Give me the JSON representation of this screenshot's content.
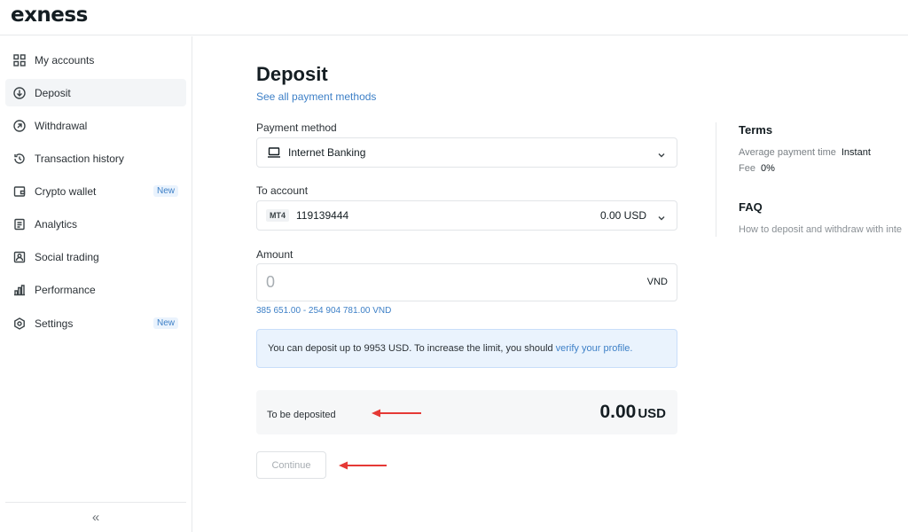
{
  "brand": {
    "logo_text": "exness"
  },
  "sidebar": {
    "items": [
      {
        "label": "My accounts",
        "icon": "grid-icon"
      },
      {
        "label": "Deposit",
        "icon": "arrow-down-circle-icon",
        "active": true
      },
      {
        "label": "Withdrawal",
        "icon": "arrow-up-right-circle-icon"
      },
      {
        "label": "Transaction history",
        "icon": "history-icon"
      },
      {
        "label": "Crypto wallet",
        "icon": "wallet-icon",
        "badge": "New"
      },
      {
        "label": "Analytics",
        "icon": "document-icon"
      },
      {
        "label": "Social trading",
        "icon": "social-trading-icon"
      },
      {
        "label": "Performance",
        "icon": "bar-chart-icon"
      },
      {
        "label": "Settings",
        "icon": "gear-icon",
        "badge": "New"
      }
    ],
    "collapse_label": "«"
  },
  "deposit": {
    "title": "Deposit",
    "see_all_link": "See all payment methods",
    "payment_method": {
      "label": "Payment method",
      "value": "Internet Banking",
      "icon": "laptop-icon"
    },
    "to_account": {
      "label": "To account",
      "platform": "MT4",
      "number": "119139444",
      "balance": "0.00 USD"
    },
    "amount": {
      "label": "Amount",
      "placeholder": "0",
      "value": "",
      "currency": "VND",
      "range": "385 651.00 - 254 904 781.00 VND"
    },
    "info": {
      "text": "You can deposit up to 9953 USD. To increase the limit, you should",
      "link": "verify your profile."
    },
    "summary": {
      "label": "To be deposited",
      "amount": "0.00",
      "currency": "USD"
    },
    "continue_label": "Continue"
  },
  "terms": {
    "title": "Terms",
    "payment_time_label": "Average payment time",
    "payment_time_value": "Instant",
    "fee_label": "Fee",
    "fee_value": "0%"
  },
  "faq": {
    "title": "FAQ",
    "link": "How to deposit and withdraw with inte"
  },
  "colors": {
    "accent": "#3e80c7",
    "annotation_arrow": "#e53935",
    "info_bg": "#eaf3fd"
  }
}
